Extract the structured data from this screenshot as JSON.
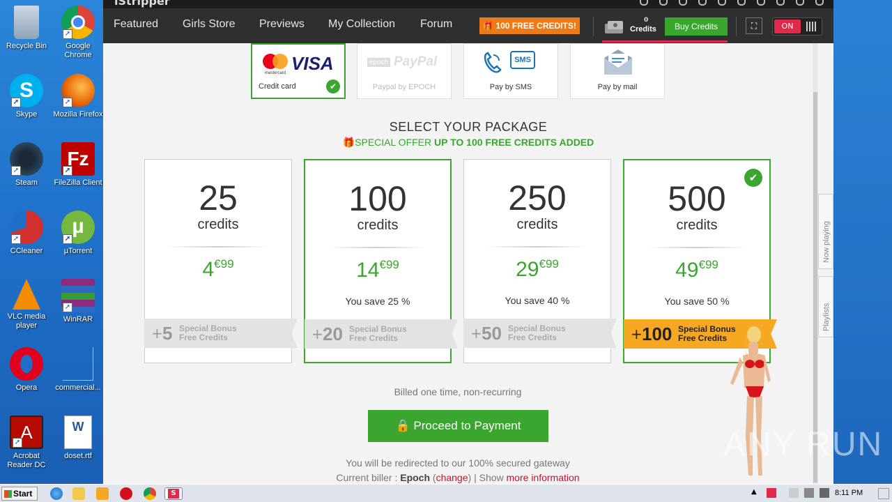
{
  "desktop": {
    "icons": [
      {
        "label": "Recycle Bin",
        "icon": "recycle-bin-icon"
      },
      {
        "label": "Google Chrome",
        "icon": "chrome-icon"
      },
      {
        "label": "Skype",
        "icon": "skype-icon"
      },
      {
        "label": "Mozilla Firefox",
        "icon": "firefox-icon"
      },
      {
        "label": "Steam",
        "icon": "steam-icon"
      },
      {
        "label": "FileZilla Client",
        "icon": "filezilla-icon"
      },
      {
        "label": "CCleaner",
        "icon": "ccleaner-icon"
      },
      {
        "label": "µTorrent",
        "icon": "utorrent-icon"
      },
      {
        "label": "VLC media player",
        "icon": "vlc-icon"
      },
      {
        "label": "WinRAR",
        "icon": "winrar-icon"
      },
      {
        "label": "Opera",
        "icon": "opera-icon"
      },
      {
        "label": "commercial...",
        "icon": "blank-file-icon"
      },
      {
        "label": "Acrobat Reader DC",
        "icon": "acrobat-icon"
      },
      {
        "label": "doset.rtf",
        "icon": "word-doc-icon"
      }
    ]
  },
  "app": {
    "title": "iStripper",
    "nav": [
      "Featured",
      "Girls Store",
      "Previews",
      "My Collection",
      "Forum"
    ],
    "free_credits_button": "100 FREE CREDITS!",
    "credits_count": "0",
    "credits_label": "Credits",
    "buy_credits_button": "Buy Credits",
    "toggle_label": "ON"
  },
  "payment_methods": [
    {
      "label": "Credit card",
      "selected": true
    },
    {
      "label": "Paypal by EPOCH",
      "selected": false
    },
    {
      "label": "Pay by SMS",
      "selected": false
    },
    {
      "label": "Pay by mail",
      "selected": false
    }
  ],
  "payment_logos": {
    "visa": "VISA",
    "mastercard": "mastercard",
    "epoch": "epoch",
    "paypal": "PayPal",
    "sms": "SMS"
  },
  "package_section": {
    "heading": "SELECT YOUR PACKAGE",
    "offer_prefix": "SPECIAL OFFER ",
    "offer_bold": "UP TO 100 FREE CREDITS ADDED"
  },
  "packages": [
    {
      "amount": "25",
      "unit": "credits",
      "price_main": "4",
      "price_cents": "€99",
      "save": "",
      "bonus": "5",
      "bonus_line1": "Special Bonus",
      "bonus_line2": "Free Credits",
      "selected": false
    },
    {
      "amount": "100",
      "unit": "credits",
      "price_main": "14",
      "price_cents": "€99",
      "save": "You save 25 %",
      "bonus": "20",
      "bonus_line1": "Special Bonus",
      "bonus_line2": "Free Credits",
      "selected": false
    },
    {
      "amount": "250",
      "unit": "credits",
      "price_main": "29",
      "price_cents": "€99",
      "save": "You save 40 %",
      "bonus": "50",
      "bonus_line1": "Special Bonus",
      "bonus_line2": "Free Credits",
      "selected": false
    },
    {
      "amount": "500",
      "unit": "credits",
      "price_main": "49",
      "price_cents": "€99",
      "save": "You save 50 %",
      "bonus": "100",
      "bonus_line1": "Special Bonus",
      "bonus_line2": "Free Credits",
      "selected": true
    }
  ],
  "checkout": {
    "billed_note": "Billed one time, non-recurring",
    "proceed_button": "Proceed to Payment",
    "redirect_note": "You will be redirected to our 100% secured gateway",
    "biller_prefix": "Current biller : ",
    "biller_name": "Epoch",
    "change_link": "change",
    "show_prefix": " | Show ",
    "more_info_link": "more information"
  },
  "side_tabs": [
    "Now playing",
    "Playlists"
  ],
  "watermark": "ANY RUN",
  "taskbar": {
    "start_label": "Start",
    "clock": "8:11 PM"
  },
  "colors": {
    "accent_green": "#3aa52f",
    "accent_orange": "#ee7a16",
    "accent_red": "#e0294b",
    "bonus_gold": "#f7a823"
  }
}
